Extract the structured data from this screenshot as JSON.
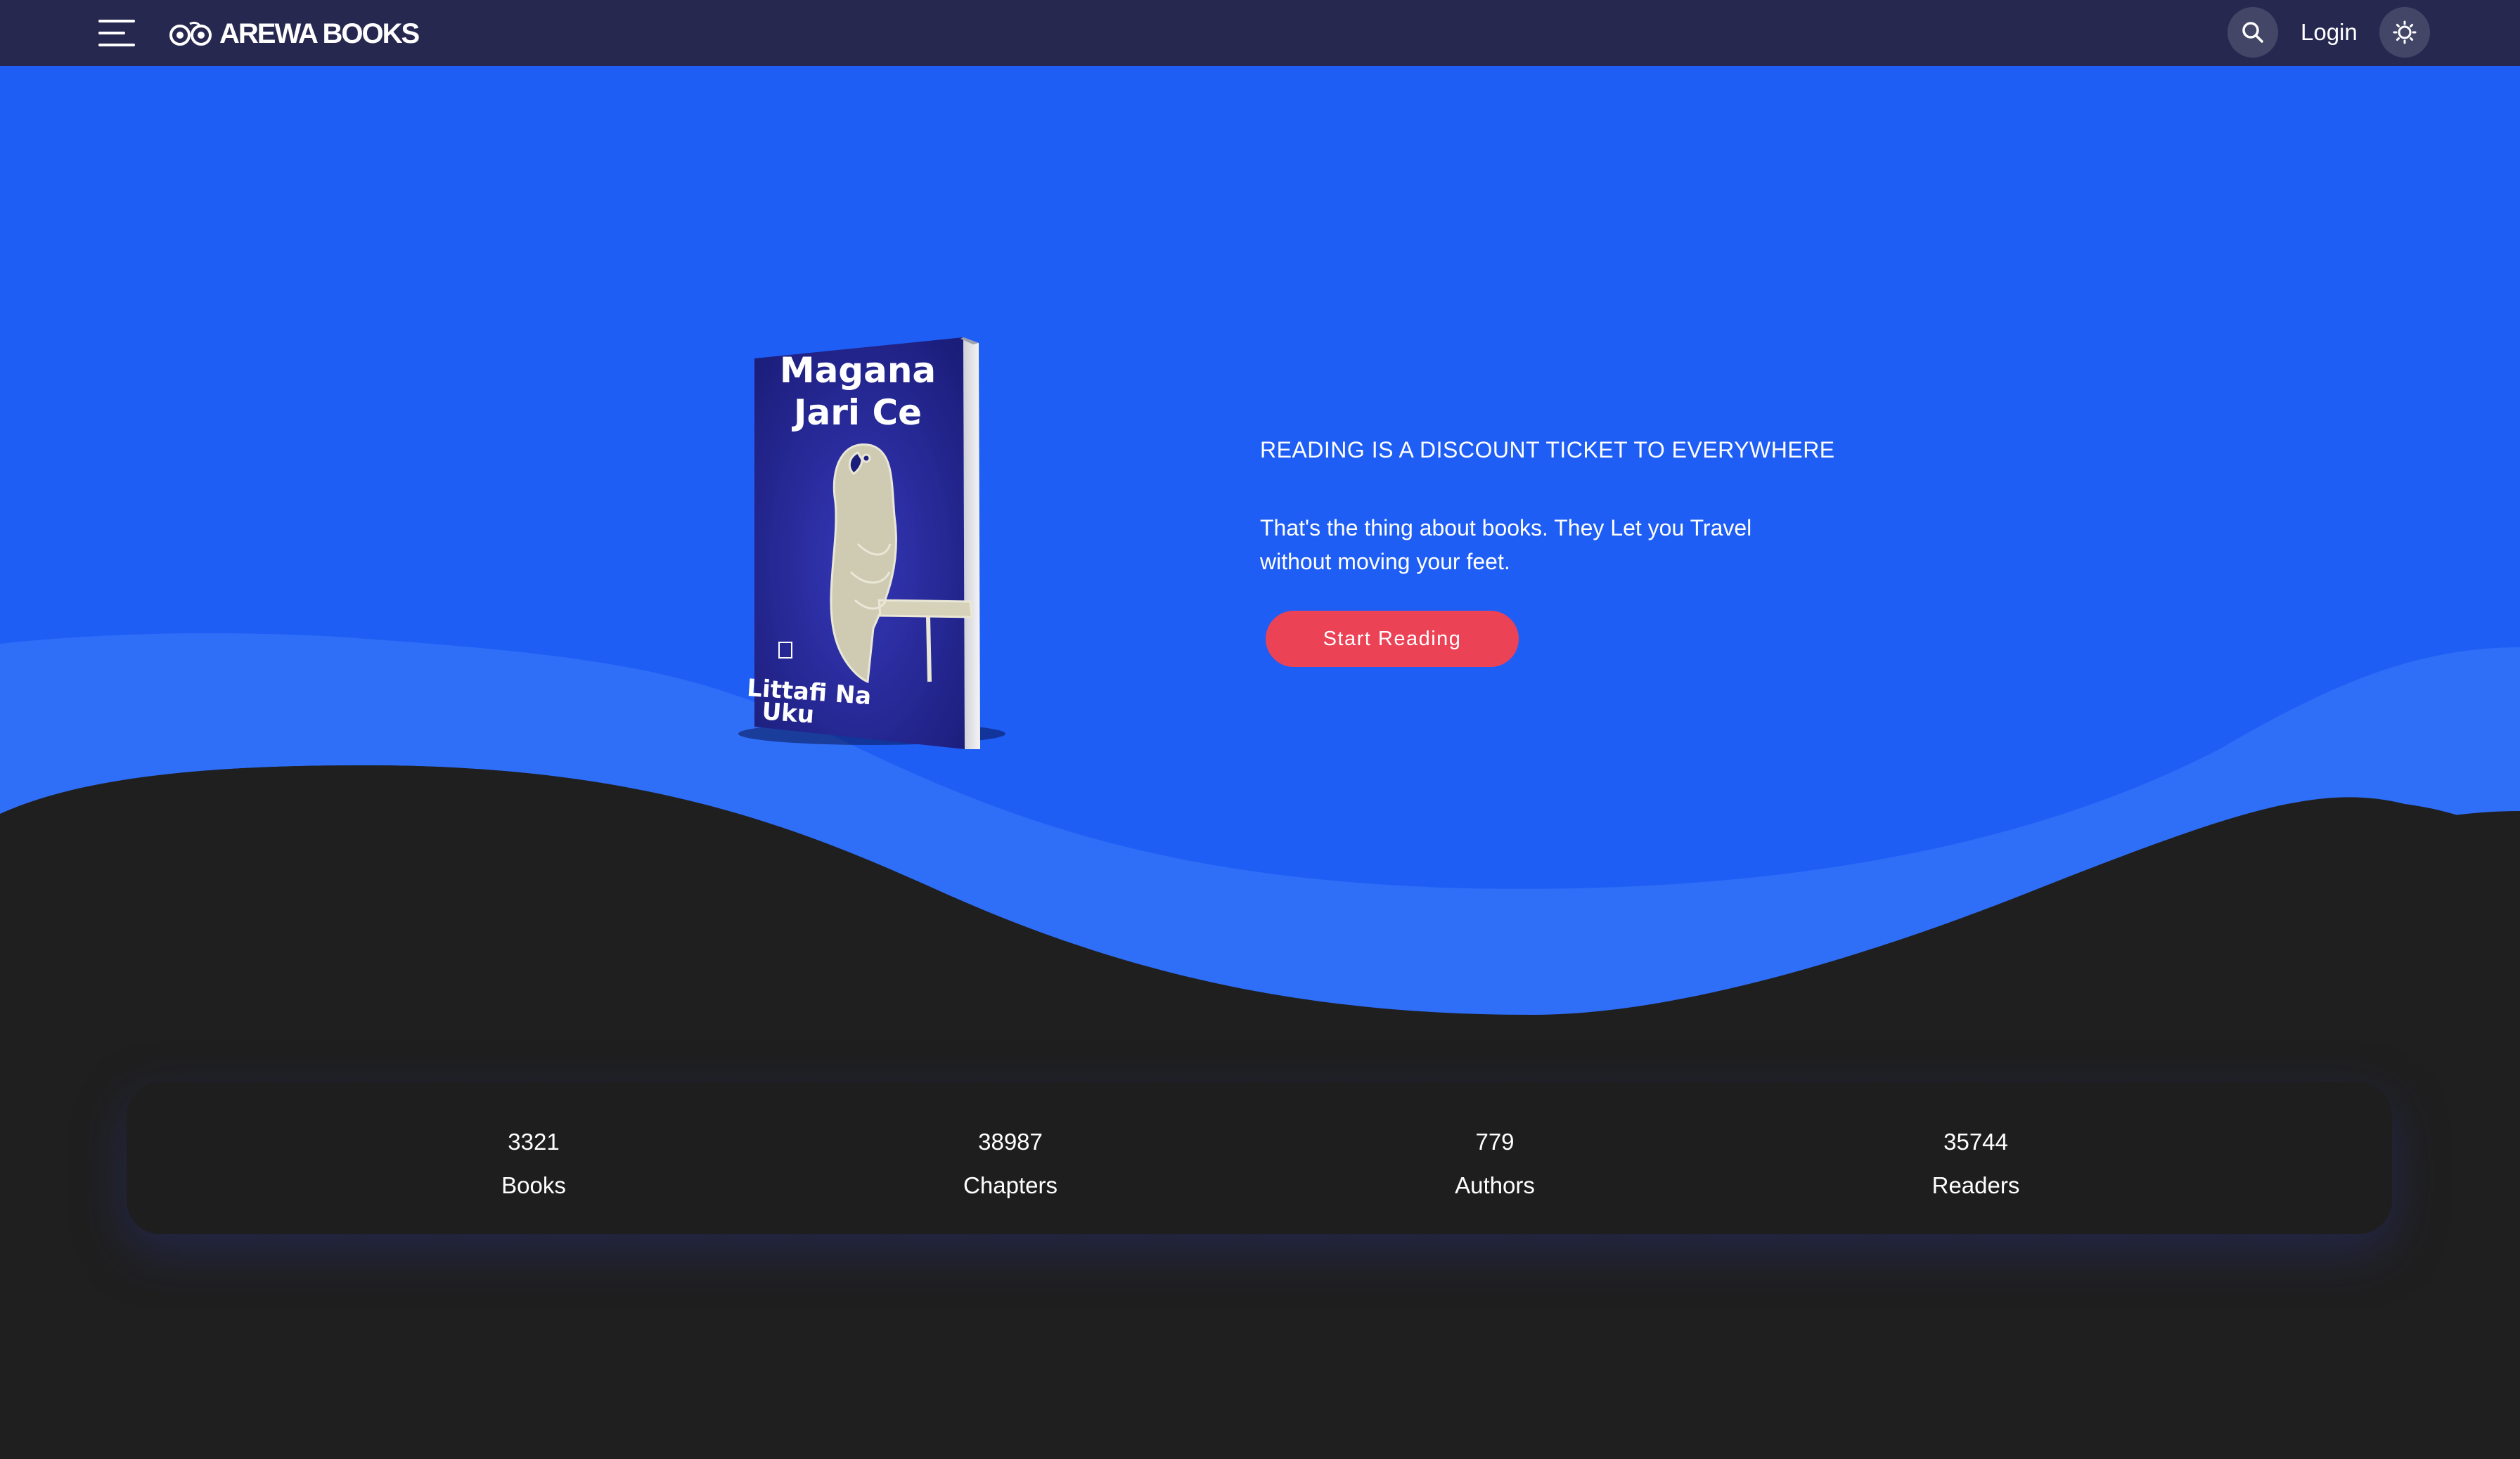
{
  "navbar": {
    "brand": "AREWA BOOKS",
    "login_label": "Login",
    "icons": {
      "menu": "menu-icon",
      "search": "search-icon",
      "theme": "theme-toggle-icon"
    }
  },
  "hero": {
    "book": {
      "title_line1": "Magana",
      "title_line2": "Jari Ce",
      "author_line1": "Littafi Na",
      "author_line2": "Uku"
    },
    "tagline": "READING IS A DISCOUNT TICKET TO EVERYWHERE",
    "subtext": "That's the thing about books. They Let you Travel without moving your feet.",
    "cta_label": "Start Reading"
  },
  "stats": [
    {
      "value": "3321",
      "label": "Books"
    },
    {
      "value": "38987",
      "label": "Chapters"
    },
    {
      "value": "779",
      "label": "Authors"
    },
    {
      "value": "35744",
      "label": "Readers"
    }
  ],
  "colors": {
    "navbar": "#262850",
    "hero_blue": "#1e5ef5",
    "wave_light": "#3a7af6",
    "page_dark": "#1f1f1f",
    "cta": "#ec4256"
  }
}
